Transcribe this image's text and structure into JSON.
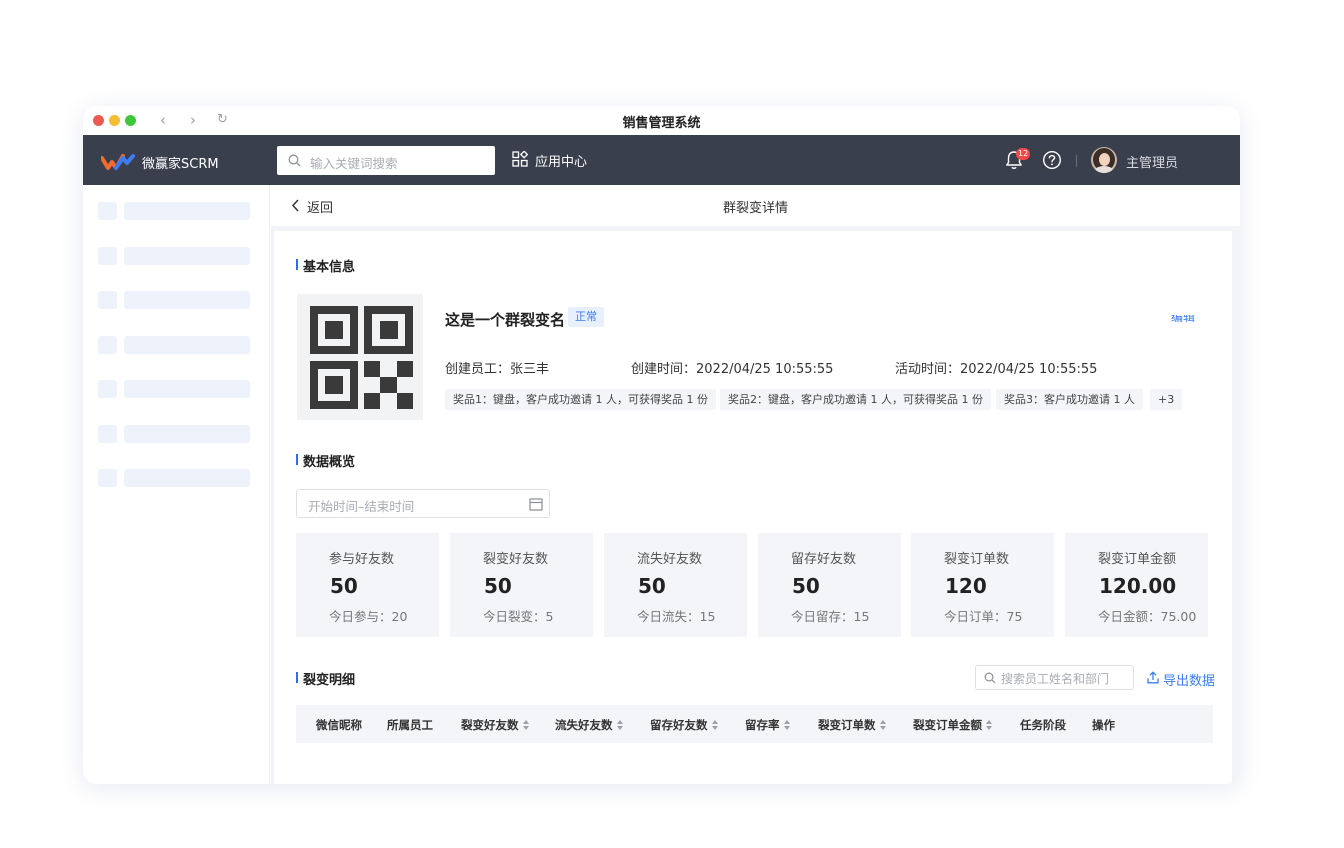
{
  "window": {
    "title": "销售管理系统"
  },
  "header": {
    "brand": "微赢家SCRM",
    "search_placeholder": "输入关键词搜索",
    "app_center": "应用中心",
    "notification_count": "12",
    "user_name": "主管理员"
  },
  "subheader": {
    "back_label": "返回",
    "page_title": "群裂变详情"
  },
  "basic": {
    "section_title": "基本信息",
    "activity_name": "这是一个群裂变名",
    "status": "正常",
    "edit_label": "编辑",
    "creator": "创建员工：张三丰",
    "created_time": "创建时间：2022/04/25 10:55:55",
    "activity_time": "活动时间：2022/04/25 10:55:55",
    "prizes": [
      "奖品1：键盘，客户成功邀请 1 人，可获得奖品 1 份",
      "奖品2：键盘，客户成功邀请 1 人，可获得奖品 1 份",
      "奖品3：客户成功邀请 1 人"
    ],
    "more_prizes": "+3"
  },
  "overview": {
    "section_title": "数据概览",
    "date_placeholder": "开始时间–结束时间",
    "stats": [
      {
        "label": "参与好友数",
        "value": "50",
        "sub": "今日参与：20"
      },
      {
        "label": "裂变好友数",
        "value": "50",
        "sub": "今日裂变：5"
      },
      {
        "label": "流失好友数",
        "value": "50",
        "sub": "今日流失：15"
      },
      {
        "label": "留存好友数",
        "value": "50",
        "sub": "今日留存：15"
      },
      {
        "label": "裂变订单数",
        "value": "120",
        "sub": "今日订单：75"
      },
      {
        "label": "裂变订单金额",
        "value": "120.00",
        "sub": "今日金额：75.00"
      }
    ]
  },
  "detail": {
    "section_title": "裂变明细",
    "search_placeholder": "搜索员工姓名和部门",
    "export_label": "导出数据",
    "columns": [
      "微信昵称",
      "所属员工",
      "裂变好友数",
      "流失好友数",
      "留存好友数",
      "留存率",
      "裂变订单数",
      "裂变订单金额",
      "任务阶段",
      "操作"
    ]
  },
  "colors": {
    "topbar": "#3a3f4e",
    "accent": "#3b7cf4",
    "badge": "#f24848"
  }
}
